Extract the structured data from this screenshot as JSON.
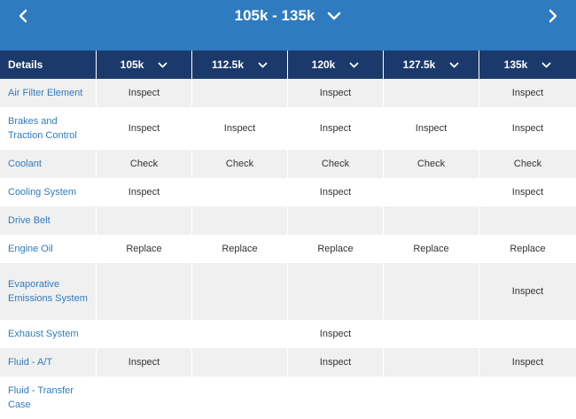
{
  "header": {
    "range_title": "105k - 135k",
    "icons": {
      "prev": "chevron-left-icon",
      "next": "chevron-right-icon",
      "dropdown": "chevron-down-icon"
    }
  },
  "colors": {
    "topbar": "#2f7bbf",
    "table_header": "#1b3a6b",
    "link": "#2f7bbf",
    "row_shade": "#f0f0f0"
  },
  "table": {
    "details_label": "Details",
    "milestones": [
      "105k",
      "112.5k",
      "120k",
      "127.5k",
      "135k"
    ],
    "rows": [
      {
        "label": "Air Filter Element",
        "values": [
          "Inspect",
          "",
          "Inspect",
          "",
          "Inspect"
        ]
      },
      {
        "label": "Brakes and Traction Control",
        "values": [
          "Inspect",
          "Inspect",
          "Inspect",
          "Inspect",
          "Inspect"
        ]
      },
      {
        "label": "Coolant",
        "values": [
          "Check",
          "Check",
          "Check",
          "Check",
          "Check"
        ]
      },
      {
        "label": "Cooling System",
        "values": [
          "Inspect",
          "",
          "Inspect",
          "",
          "Inspect"
        ]
      },
      {
        "label": "Drive Belt",
        "values": [
          "",
          "",
          "",
          "",
          ""
        ]
      },
      {
        "label": "Engine Oil",
        "values": [
          "Replace",
          "Replace",
          "Replace",
          "Replace",
          "Replace"
        ]
      },
      {
        "label": "Evaporative Emissions System",
        "values": [
          "",
          "",
          "",
          "",
          "Inspect"
        ]
      },
      {
        "label": "Exhaust System",
        "values": [
          "",
          "",
          "Inspect",
          "",
          ""
        ]
      },
      {
        "label": "Fluid - A/T",
        "values": [
          "Inspect",
          "",
          "Inspect",
          "",
          "Inspect"
        ]
      },
      {
        "label": "Fluid - Transfer Case",
        "values": [
          "",
          "",
          "",
          "",
          ""
        ]
      }
    ]
  }
}
